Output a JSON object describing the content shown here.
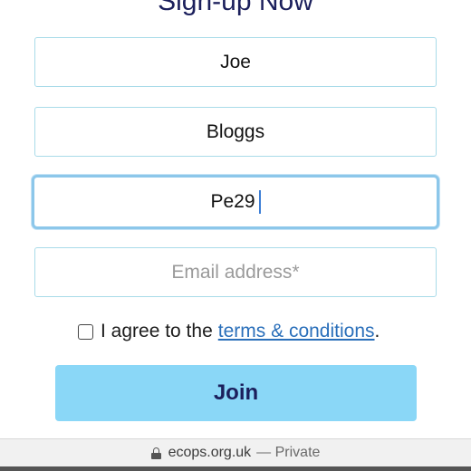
{
  "form": {
    "title": "Sign-up Now",
    "first_name_value": "Joe",
    "last_name_value": "Bloggs",
    "third_field_value": "Pe29",
    "email_placeholder": "Email address*",
    "agree_text": "I agree to the",
    "terms_link": "terms & conditions",
    "agree_period": ".",
    "join_label": "Join"
  },
  "browser": {
    "domain": "ecops.org.uk",
    "private_label": "— Private",
    "lock_icon": "lock-icon"
  },
  "colors": {
    "title": "#1b1f5c",
    "field_border": "#a9dbe9",
    "focus_border": "#8cc7ea",
    "link": "#2a6fba",
    "button_bg": "#8ad7f7",
    "button_text": "#1b1f5c"
  }
}
